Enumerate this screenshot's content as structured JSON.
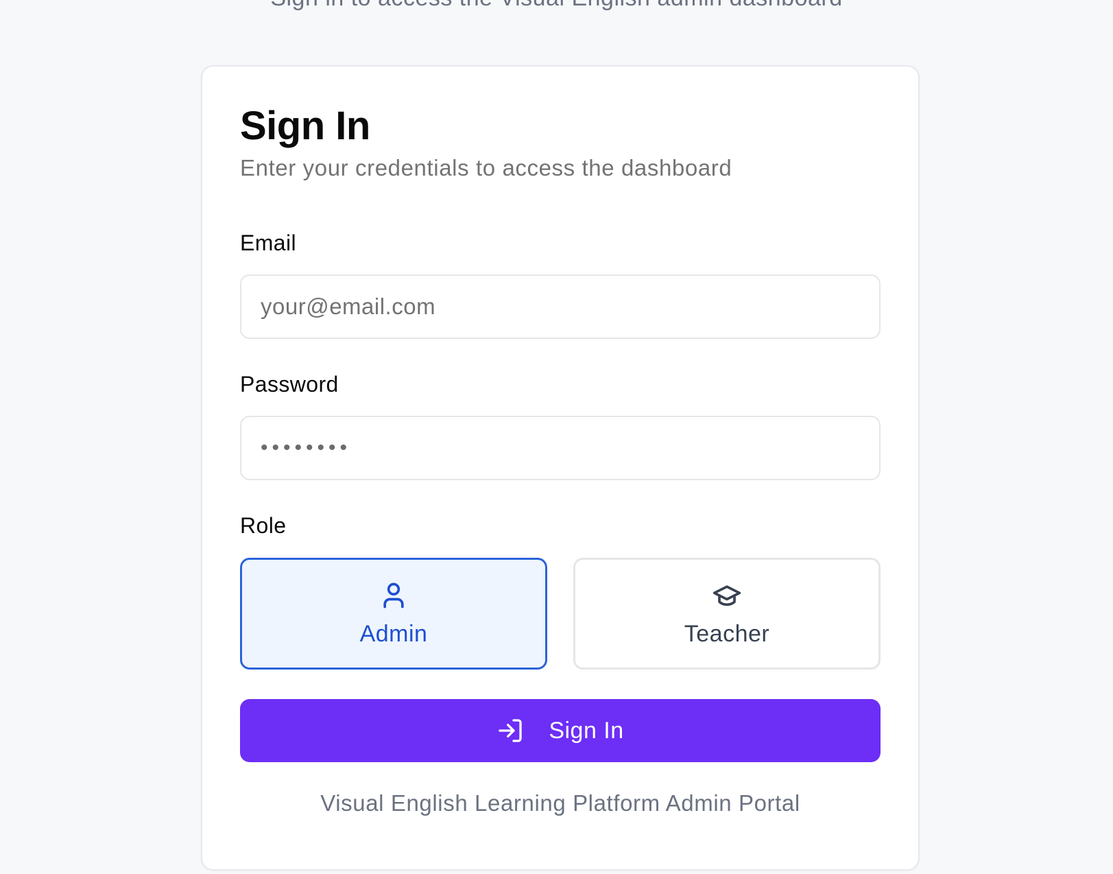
{
  "header": {
    "subtitle": "Sign in to access the Visual English admin dashboard"
  },
  "card": {
    "title": "Sign In",
    "description": "Enter your credentials to access the dashboard"
  },
  "form": {
    "email": {
      "label": "Email",
      "placeholder": "your@email.com",
      "value": ""
    },
    "password": {
      "label": "Password",
      "value": "••••••••"
    },
    "role": {
      "label": "Role",
      "selected": "Admin",
      "options": [
        {
          "label": "Admin",
          "icon": "user-icon"
        },
        {
          "label": "Teacher",
          "icon": "graduation-cap-icon"
        }
      ]
    },
    "submit": {
      "label": "Sign In",
      "icon": "log-in-icon"
    }
  },
  "footer": {
    "text": "Visual English Learning Platform Admin Portal"
  },
  "colors": {
    "background": "#f7f8fa",
    "card": "#ffffff",
    "accent_button": "#6d2ef6",
    "selected_role_border": "#2b63d9",
    "selected_role_background": "#eff5fe",
    "selected_role_text": "#1d4fd0"
  }
}
